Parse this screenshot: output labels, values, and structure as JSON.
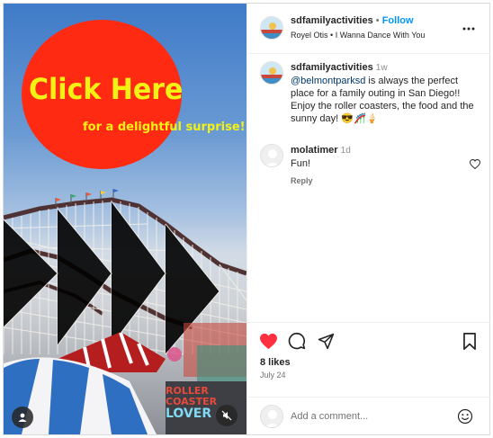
{
  "post": {
    "username": "sdfamilyactivities",
    "follow_label": "Follow",
    "audio_artist": "Royel Otis",
    "audio_track": "I Wanna Dance With You",
    "bullet": "•"
  },
  "media": {
    "badge_title": "Click Here",
    "badge_subtitle": "for a delightful surprise!",
    "neon_line1": "ROLLER",
    "neon_line2": "COASTER",
    "neon_line3": "LOVER",
    "badge_color": "#ff2a12",
    "badge_text_color": "#f3f214"
  },
  "caption": {
    "username": "sdfamilyactivities",
    "time": "1w",
    "mention": "@belmontparksd",
    "text": " is always the perfect place for a family outing in San Diego!! Enjoy the roller coasters, the food and the sunny day! 😎🎢🍦"
  },
  "comments": [
    {
      "username": "molatimer",
      "time": "1d",
      "text": "Fun!",
      "reply_label": "Reply"
    }
  ],
  "engagement": {
    "likes": "8 likes",
    "date": "July 24",
    "like_color": "#ff3040"
  },
  "add_comment": {
    "placeholder": "Add a comment..."
  },
  "icons": [
    "user-tag-icon",
    "mute-icon",
    "more-icon",
    "heart-icon",
    "comment-icon",
    "share-icon",
    "bookmark-icon",
    "small-heart-icon",
    "emoji-icon"
  ]
}
